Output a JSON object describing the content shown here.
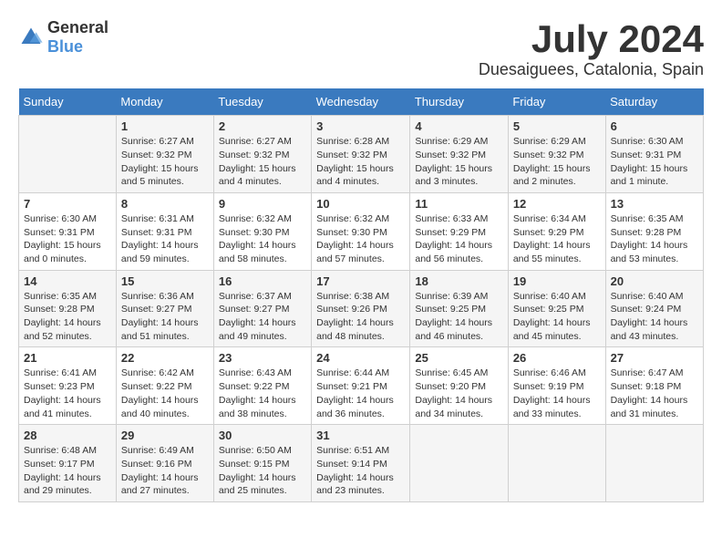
{
  "logo": {
    "general": "General",
    "blue": "Blue"
  },
  "title": {
    "month_year": "July 2024",
    "location": "Duesaiguees, Catalonia, Spain"
  },
  "calendar": {
    "headers": [
      "Sunday",
      "Monday",
      "Tuesday",
      "Wednesday",
      "Thursday",
      "Friday",
      "Saturday"
    ],
    "weeks": [
      [
        {
          "day": "",
          "info": ""
        },
        {
          "day": "1",
          "info": "Sunrise: 6:27 AM\nSunset: 9:32 PM\nDaylight: 15 hours\nand 5 minutes."
        },
        {
          "day": "2",
          "info": "Sunrise: 6:27 AM\nSunset: 9:32 PM\nDaylight: 15 hours\nand 4 minutes."
        },
        {
          "day": "3",
          "info": "Sunrise: 6:28 AM\nSunset: 9:32 PM\nDaylight: 15 hours\nand 4 minutes."
        },
        {
          "day": "4",
          "info": "Sunrise: 6:29 AM\nSunset: 9:32 PM\nDaylight: 15 hours\nand 3 minutes."
        },
        {
          "day": "5",
          "info": "Sunrise: 6:29 AM\nSunset: 9:32 PM\nDaylight: 15 hours\nand 2 minutes."
        },
        {
          "day": "6",
          "info": "Sunrise: 6:30 AM\nSunset: 9:31 PM\nDaylight: 15 hours\nand 1 minute."
        }
      ],
      [
        {
          "day": "7",
          "info": "Sunrise: 6:30 AM\nSunset: 9:31 PM\nDaylight: 15 hours\nand 0 minutes."
        },
        {
          "day": "8",
          "info": "Sunrise: 6:31 AM\nSunset: 9:31 PM\nDaylight: 14 hours\nand 59 minutes."
        },
        {
          "day": "9",
          "info": "Sunrise: 6:32 AM\nSunset: 9:30 PM\nDaylight: 14 hours\nand 58 minutes."
        },
        {
          "day": "10",
          "info": "Sunrise: 6:32 AM\nSunset: 9:30 PM\nDaylight: 14 hours\nand 57 minutes."
        },
        {
          "day": "11",
          "info": "Sunrise: 6:33 AM\nSunset: 9:29 PM\nDaylight: 14 hours\nand 56 minutes."
        },
        {
          "day": "12",
          "info": "Sunrise: 6:34 AM\nSunset: 9:29 PM\nDaylight: 14 hours\nand 55 minutes."
        },
        {
          "day": "13",
          "info": "Sunrise: 6:35 AM\nSunset: 9:28 PM\nDaylight: 14 hours\nand 53 minutes."
        }
      ],
      [
        {
          "day": "14",
          "info": "Sunrise: 6:35 AM\nSunset: 9:28 PM\nDaylight: 14 hours\nand 52 minutes."
        },
        {
          "day": "15",
          "info": "Sunrise: 6:36 AM\nSunset: 9:27 PM\nDaylight: 14 hours\nand 51 minutes."
        },
        {
          "day": "16",
          "info": "Sunrise: 6:37 AM\nSunset: 9:27 PM\nDaylight: 14 hours\nand 49 minutes."
        },
        {
          "day": "17",
          "info": "Sunrise: 6:38 AM\nSunset: 9:26 PM\nDaylight: 14 hours\nand 48 minutes."
        },
        {
          "day": "18",
          "info": "Sunrise: 6:39 AM\nSunset: 9:25 PM\nDaylight: 14 hours\nand 46 minutes."
        },
        {
          "day": "19",
          "info": "Sunrise: 6:40 AM\nSunset: 9:25 PM\nDaylight: 14 hours\nand 45 minutes."
        },
        {
          "day": "20",
          "info": "Sunrise: 6:40 AM\nSunset: 9:24 PM\nDaylight: 14 hours\nand 43 minutes."
        }
      ],
      [
        {
          "day": "21",
          "info": "Sunrise: 6:41 AM\nSunset: 9:23 PM\nDaylight: 14 hours\nand 41 minutes."
        },
        {
          "day": "22",
          "info": "Sunrise: 6:42 AM\nSunset: 9:22 PM\nDaylight: 14 hours\nand 40 minutes."
        },
        {
          "day": "23",
          "info": "Sunrise: 6:43 AM\nSunset: 9:22 PM\nDaylight: 14 hours\nand 38 minutes."
        },
        {
          "day": "24",
          "info": "Sunrise: 6:44 AM\nSunset: 9:21 PM\nDaylight: 14 hours\nand 36 minutes."
        },
        {
          "day": "25",
          "info": "Sunrise: 6:45 AM\nSunset: 9:20 PM\nDaylight: 14 hours\nand 34 minutes."
        },
        {
          "day": "26",
          "info": "Sunrise: 6:46 AM\nSunset: 9:19 PM\nDaylight: 14 hours\nand 33 minutes."
        },
        {
          "day": "27",
          "info": "Sunrise: 6:47 AM\nSunset: 9:18 PM\nDaylight: 14 hours\nand 31 minutes."
        }
      ],
      [
        {
          "day": "28",
          "info": "Sunrise: 6:48 AM\nSunset: 9:17 PM\nDaylight: 14 hours\nand 29 minutes."
        },
        {
          "day": "29",
          "info": "Sunrise: 6:49 AM\nSunset: 9:16 PM\nDaylight: 14 hours\nand 27 minutes."
        },
        {
          "day": "30",
          "info": "Sunrise: 6:50 AM\nSunset: 9:15 PM\nDaylight: 14 hours\nand 25 minutes."
        },
        {
          "day": "31",
          "info": "Sunrise: 6:51 AM\nSunset: 9:14 PM\nDaylight: 14 hours\nand 23 minutes."
        },
        {
          "day": "",
          "info": ""
        },
        {
          "day": "",
          "info": ""
        },
        {
          "day": "",
          "info": ""
        }
      ]
    ]
  }
}
